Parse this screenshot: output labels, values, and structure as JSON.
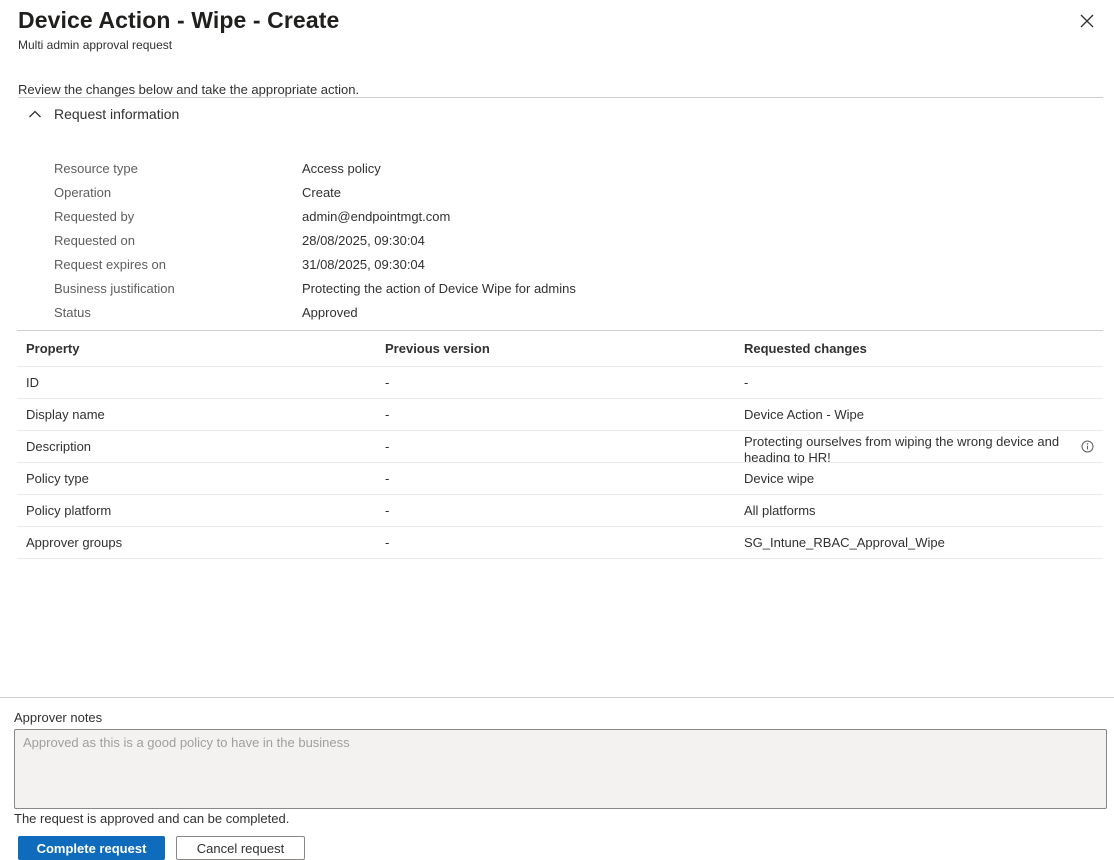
{
  "header": {
    "title": "Device Action - Wipe - Create",
    "subtitle": "Multi admin approval request",
    "close_icon": "close-icon"
  },
  "intro": "Review the changes below and take the appropriate action.",
  "request_info": {
    "section_label": "Request information",
    "toggle_icon": "chevron-up-icon",
    "rows": [
      {
        "key": "Resource type",
        "value": "Access policy"
      },
      {
        "key": "Operation",
        "value": "Create"
      },
      {
        "key": "Requested by",
        "value": "admin@endpointmgt.com"
      },
      {
        "key": "Requested on",
        "value": "28/08/2025, 09:30:04"
      },
      {
        "key": "Request expires on",
        "value": "31/08/2025, 09:30:04"
      },
      {
        "key": "Business justification",
        "value": "Protecting the action of Device Wipe for admins"
      },
      {
        "key": "Status",
        "value": "Approved"
      }
    ]
  },
  "changes_table": {
    "headers": [
      "Property",
      "Previous version",
      "Requested changes"
    ],
    "rows": [
      {
        "property": "ID",
        "previous": "-",
        "requested": "-"
      },
      {
        "property": "Display name",
        "previous": "-",
        "requested": "Device Action - Wipe"
      },
      {
        "property": "Description",
        "previous": "-",
        "requested": "Protecting ourselves from wiping the wrong device and heading to HR!"
      },
      {
        "property": "Policy type",
        "previous": "-",
        "requested": "Device wipe"
      },
      {
        "property": "Policy platform",
        "previous": "-",
        "requested": "All platforms"
      },
      {
        "property": "Approver groups",
        "previous": "-",
        "requested": "SG_Intune_RBAC_Approval_Wipe"
      }
    ]
  },
  "approver_notes": {
    "label": "Approver notes",
    "value": "Approved as this is a good policy to have in the business"
  },
  "status_message": "The request is approved and can be completed.",
  "actions": {
    "complete_label": "Complete request",
    "cancel_label": "Cancel request"
  },
  "colors": {
    "primary": "#0f6cbd",
    "text": "#323130",
    "muted": "#605e5c",
    "divider": "#d2d0ce"
  }
}
